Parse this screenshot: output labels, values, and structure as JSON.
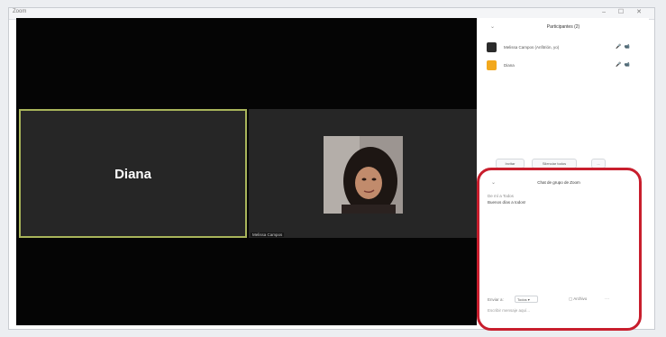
{
  "window": {
    "title": "Zoom",
    "controls": "–  ☐  ✕"
  },
  "video": {
    "tiles": [
      {
        "name": "Diana",
        "active_speaker": true
      },
      {
        "name": "Melissa Campos",
        "camera_on": true
      }
    ]
  },
  "participants": {
    "title": "Participantes (2)",
    "people": [
      {
        "name": "Melissa Campos (Anfitrión, yo)",
        "icons": "🎤 📹",
        "avatar_color": "#2b2b2b"
      },
      {
        "name": "Diana",
        "icons": "🎤 📹",
        "avatar_color": "#f2a81d"
      }
    ],
    "buttons": {
      "invite": "Invitar",
      "unmute": "Silenciar todos",
      "more": "..."
    }
  },
  "chat": {
    "title": "Chat de grupo de Zoom",
    "messages": [
      {
        "sender": "De mí a Todos",
        "text": "Buenos días a todos!"
      }
    ],
    "to_label": "Enviar a:",
    "to_value": "Todos ▾",
    "file_label": "Archivo",
    "more": "···",
    "input_placeholder": "Escribir mensaje aquí..."
  },
  "colors": {
    "video_bg": "#050505",
    "tile_bg": "#262626",
    "active_speaker_border": "#a8b45a",
    "highlight_ring": "#c81e2d"
  }
}
